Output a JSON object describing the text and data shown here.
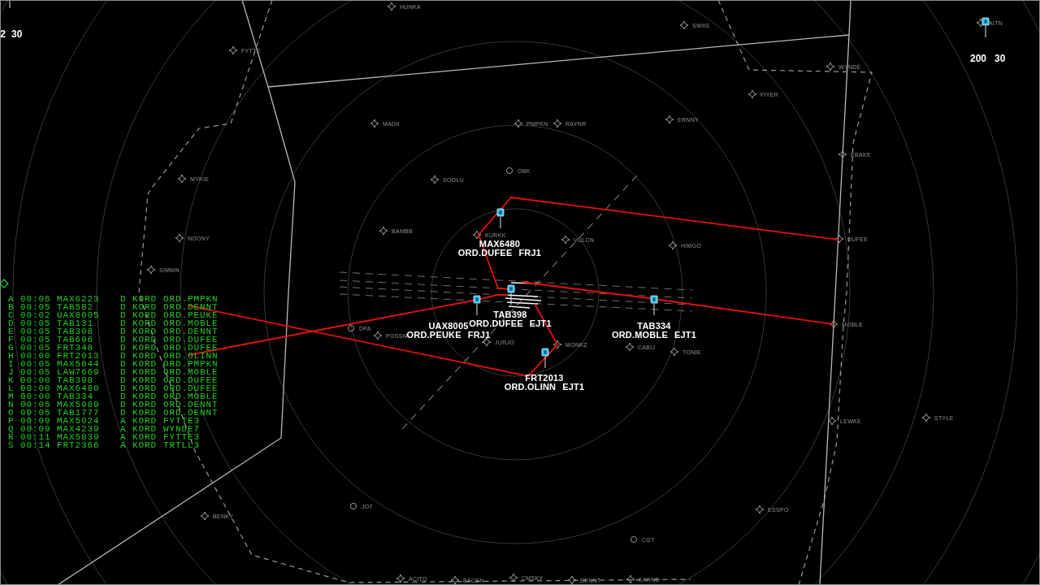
{
  "aircraft_tags": [
    {
      "altitude": "2",
      "speed": "30"
    },
    {
      "altitude": "200",
      "speed": "30"
    }
  ],
  "waypoints": [
    {
      "name": "HUNKA",
      "kind": "fix"
    },
    {
      "name": "SWIIS",
      "kind": "fix"
    },
    {
      "name": "AITN",
      "kind": "fix"
    },
    {
      "name": "FYTTE",
      "kind": "fix"
    },
    {
      "name": "WYNDE",
      "kind": "fix"
    },
    {
      "name": "FIYER",
      "kind": "fix"
    },
    {
      "name": "MADII",
      "kind": "fix"
    },
    {
      "name": "PMPKN",
      "kind": "fix"
    },
    {
      "name": "RAYNR",
      "kind": "fix"
    },
    {
      "name": "ERNNY",
      "kind": "fix"
    },
    {
      "name": "EBAKE",
      "kind": "fix"
    },
    {
      "name": "OBK",
      "kind": "navaid"
    },
    {
      "name": "MYKIE",
      "kind": "fix"
    },
    {
      "name": "SOOLU",
      "kind": "fix"
    },
    {
      "name": "BAMBB",
      "kind": "fix"
    },
    {
      "name": "NOONY",
      "kind": "fix"
    },
    {
      "name": "KURKK",
      "kind": "fix"
    },
    {
      "name": "VULCN",
      "kind": "fix"
    },
    {
      "name": "DUFEE",
      "kind": "fix"
    },
    {
      "name": "HIMGO",
      "kind": "fix"
    },
    {
      "name": "SIMMN",
      "kind": "fix"
    },
    {
      "name": "DPA",
      "kind": "navaid"
    },
    {
      "name": "MOBLE",
      "kind": "fix"
    },
    {
      "name": "POSSM",
      "kind": "fix"
    },
    {
      "name": "JURJO",
      "kind": "fix"
    },
    {
      "name": "MONKZ",
      "kind": "fix"
    },
    {
      "name": "CABIJ",
      "kind": "fix"
    },
    {
      "name": "TONIE",
      "kind": "fix"
    },
    {
      "name": "LEWKE",
      "kind": "fix"
    },
    {
      "name": "STYLE",
      "kind": "fix"
    },
    {
      "name": "JOT",
      "kind": "navaid"
    },
    {
      "name": "ESSPO",
      "kind": "fix"
    },
    {
      "name": "BENKY",
      "kind": "fix"
    },
    {
      "name": "CGT",
      "kind": "navaid"
    },
    {
      "name": "ACITO",
      "kind": "fix"
    },
    {
      "name": "BACEN",
      "kind": "fix"
    },
    {
      "name": "CMSKY",
      "kind": "fix"
    },
    {
      "name": "DENNT",
      "kind": "fix"
    },
    {
      "name": "EARND",
      "kind": "fix"
    }
  ],
  "aircraft": [
    {
      "callsign": "MAX6480",
      "route": "ORD.DUFEE",
      "code": "FRJ1"
    },
    {
      "callsign": "TAB398",
      "route": "ORD.DUFEE",
      "code": "EJT1"
    },
    {
      "callsign": "UAX8005",
      "route": "ORD.PEUKE",
      "code": "FRJ1"
    },
    {
      "callsign": "TAB334",
      "route": "ORD.MOBLE",
      "code": "EJT1"
    },
    {
      "callsign": "FRT2013",
      "route": "ORD.OLINN",
      "code": "EJT1"
    }
  ],
  "flight_list": [
    {
      "letter": "A",
      "time": "00:06",
      "callsign": "MAX6223",
      "type": "D",
      "airport": "KORD",
      "route": "ORD.PMPKN"
    },
    {
      "letter": "B",
      "time": "00:05",
      "callsign": "TAB582",
      "type": "D",
      "airport": "KORD",
      "route": "ORD.DENNT"
    },
    {
      "letter": "C",
      "time": "00:02",
      "callsign": "UAX8005",
      "type": "D",
      "airport": "KORD",
      "route": "ORD.PEUKE"
    },
    {
      "letter": "D",
      "time": "00:05",
      "callsign": "TAB131",
      "type": "D",
      "airport": "KORD",
      "route": "ORD.MOBLE"
    },
    {
      "letter": "E",
      "time": "00:05",
      "callsign": "TAB308",
      "type": "D",
      "airport": "KORD",
      "route": "ORD.DENNT"
    },
    {
      "letter": "F",
      "time": "00:05",
      "callsign": "TAB696",
      "type": "D",
      "airport": "KORD",
      "route": "ORD.DUFEE"
    },
    {
      "letter": "G",
      "time": "00:05",
      "callsign": "FRT348",
      "type": "D",
      "airport": "KORD",
      "route": "ORD.DUFEE"
    },
    {
      "letter": "H",
      "time": "00:00",
      "callsign": "FRT2013",
      "type": "D",
      "airport": "KORD",
      "route": "ORD.OLINN"
    },
    {
      "letter": "I",
      "time": "00:05",
      "callsign": "MAX5844",
      "type": "D",
      "airport": "KORD",
      "route": "ORD.PMPKN"
    },
    {
      "letter": "J",
      "time": "00:05",
      "callsign": "LAW7669",
      "type": "D",
      "airport": "KORD",
      "route": "ORD.MOBLE"
    },
    {
      "letter": "K",
      "time": "00:00",
      "callsign": "TAB398",
      "type": "D",
      "airport": "KORD",
      "route": "ORD.DUFEE"
    },
    {
      "letter": "L",
      "time": "00:00",
      "callsign": "MAX6480",
      "type": "D",
      "airport": "KORD",
      "route": "ORD.DUFEE"
    },
    {
      "letter": "M",
      "time": "00:00",
      "callsign": "TAB334",
      "type": "D",
      "airport": "KORD",
      "route": "ORD.MOBLE"
    },
    {
      "letter": "N",
      "time": "00:05",
      "callsign": "MAX5989",
      "type": "D",
      "airport": "KORD",
      "route": "ORD.DENNT"
    },
    {
      "letter": "O",
      "time": "00:05",
      "callsign": "TAB1777",
      "type": "D",
      "airport": "KORD",
      "route": "ORD.DENNT"
    },
    {
      "letter": "P",
      "time": "00:09",
      "callsign": "MAX5024",
      "type": "A",
      "airport": "KORD",
      "route": "FYTTE3"
    },
    {
      "letter": "Q",
      "time": "00:09",
      "callsign": "MAX4239",
      "type": "A",
      "airport": "KORD",
      "route": "WYNDE7"
    },
    {
      "letter": "R",
      "time": "00:11",
      "callsign": "MAX5839",
      "type": "A",
      "airport": "KORD",
      "route": "FYTTE3"
    },
    {
      "letter": "S",
      "time": "00:14",
      "callsign": "FRT2366",
      "type": "A",
      "airport": "KORD",
      "route": "TRTLL3"
    }
  ]
}
